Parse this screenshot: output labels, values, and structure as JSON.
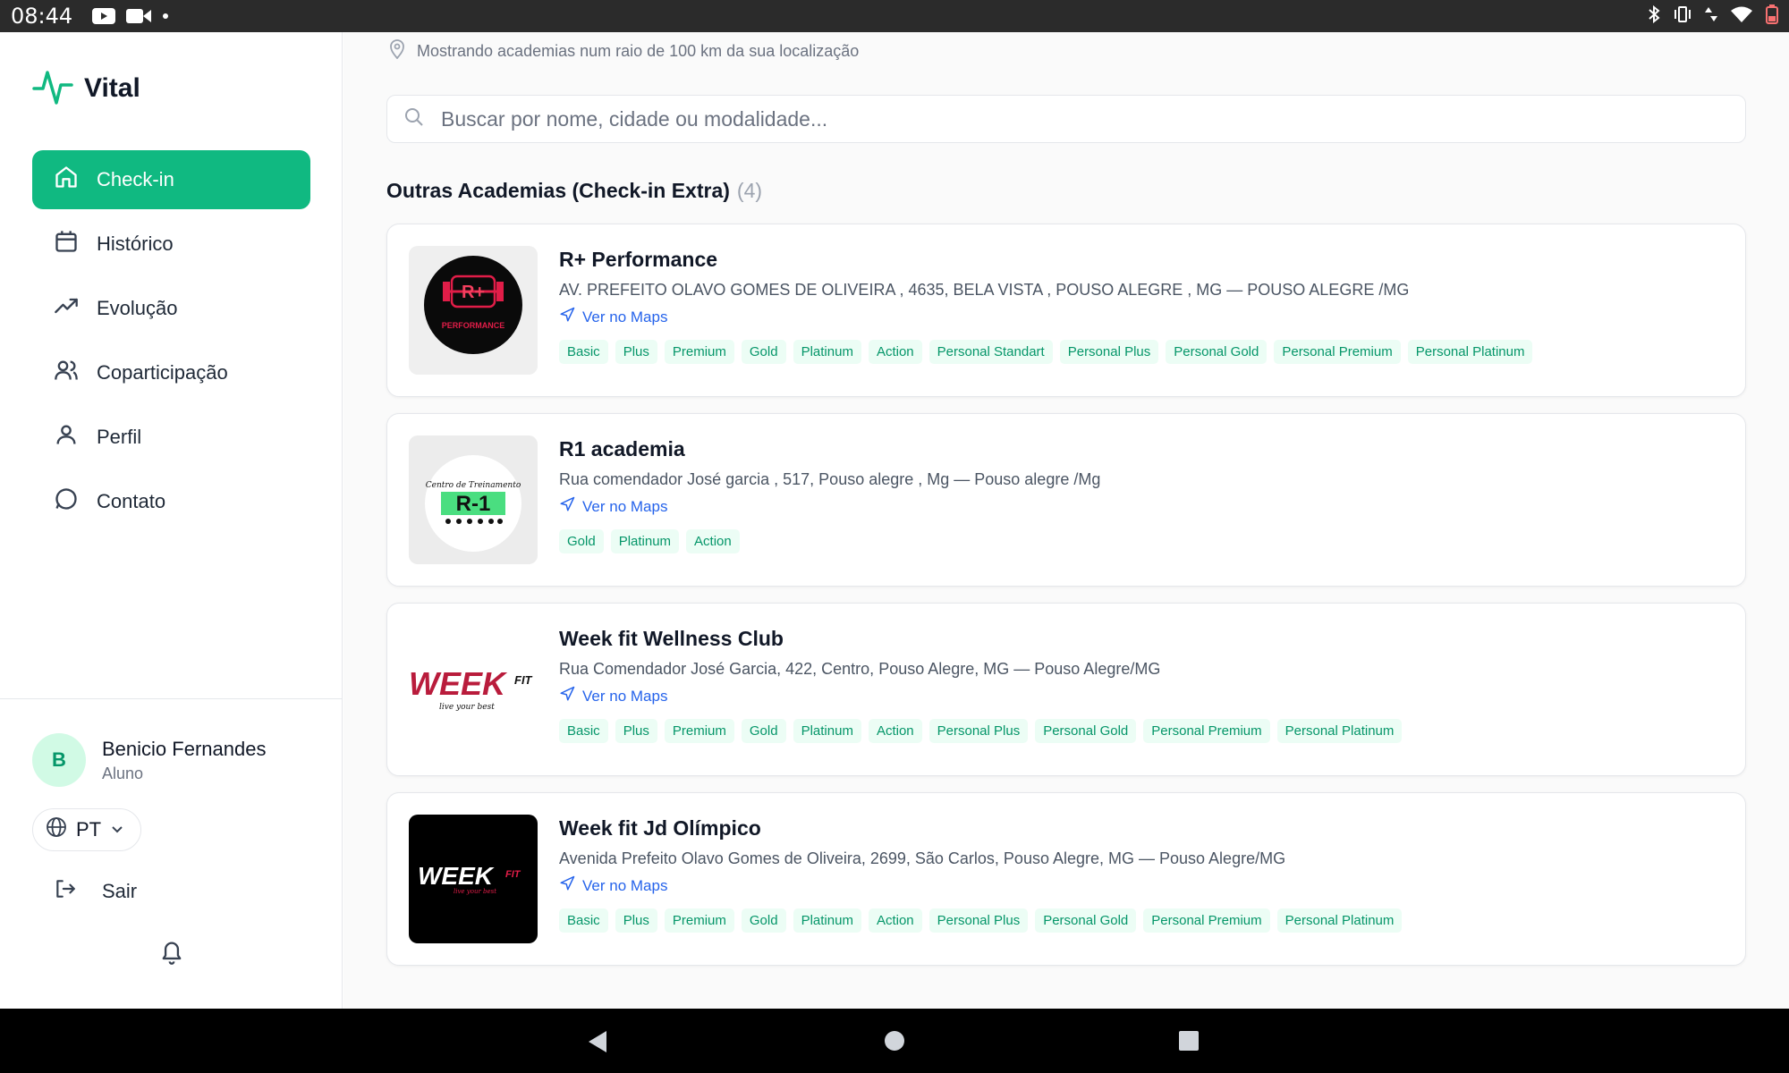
{
  "status_bar": {
    "time": "08:44"
  },
  "brand": {
    "name": "Vital"
  },
  "nav": [
    {
      "label": "Check-in",
      "icon": "home-icon"
    },
    {
      "label": "Histórico",
      "icon": "calendar-icon"
    },
    {
      "label": "Evolução",
      "icon": "trending-up-icon"
    },
    {
      "label": "Coparticipação",
      "icon": "users-icon"
    },
    {
      "label": "Perfil",
      "icon": "user-icon"
    },
    {
      "label": "Contato",
      "icon": "message-icon"
    }
  ],
  "user": {
    "initial": "B",
    "name": "Benicio Fernandes",
    "role": "Aluno"
  },
  "language": {
    "selected": "PT"
  },
  "logout_label": "Sair",
  "location_note": "Mostrando academias num raio de 100 km da sua localização",
  "search": {
    "placeholder": "Buscar por nome, cidade ou modalidade..."
  },
  "section": {
    "title": "Outras Academias (Check-in Extra)",
    "count": "(4)"
  },
  "maps_label": "Ver no Maps",
  "gyms": [
    {
      "name": "R+ Performance",
      "address": "AV. PREFEITO OLAVO GOMES DE OLIVEIRA , 4635, BELA VISTA , POUSO ALEGRE , MG — POUSO ALEGRE /MG",
      "logo_text": "PERFORMANCE",
      "tags": [
        "Basic",
        "Plus",
        "Premium",
        "Gold",
        "Platinum",
        "Action",
        "Personal Standart",
        "Personal Plus",
        "Personal Gold",
        "Personal Premium",
        "Personal Platinum"
      ]
    },
    {
      "name": "R1 academia",
      "address": "Rua comendador José garcia , 517, Pouso alegre , Mg — Pouso alegre /Mg",
      "logo_text": "R-1",
      "tags": [
        "Gold",
        "Platinum",
        "Action"
      ]
    },
    {
      "name": "Week fit Wellness Club",
      "address": "Rua Comendador José Garcia, 422, Centro, Pouso Alegre, MG — Pouso Alegre/MG",
      "logo_text": "WEEK",
      "tags": [
        "Basic",
        "Plus",
        "Premium",
        "Gold",
        "Platinum",
        "Action",
        "Personal Plus",
        "Personal Gold",
        "Personal Premium",
        "Personal Platinum"
      ]
    },
    {
      "name": "Week fit Jd Olímpico",
      "address": "Avenida Prefeito Olavo Gomes de Oliveira, 2699, São Carlos, Pouso Alegre, MG — Pouso Alegre/MG",
      "logo_text": "WEEK",
      "tags": [
        "Basic",
        "Plus",
        "Premium",
        "Gold",
        "Platinum",
        "Action",
        "Personal Plus",
        "Personal Gold",
        "Personal Premium",
        "Personal Platinum"
      ]
    }
  ],
  "colors": {
    "accent": "#10b981",
    "link": "#2563eb",
    "tag_bg": "#ecfdf5",
    "tag_text": "#059669"
  }
}
